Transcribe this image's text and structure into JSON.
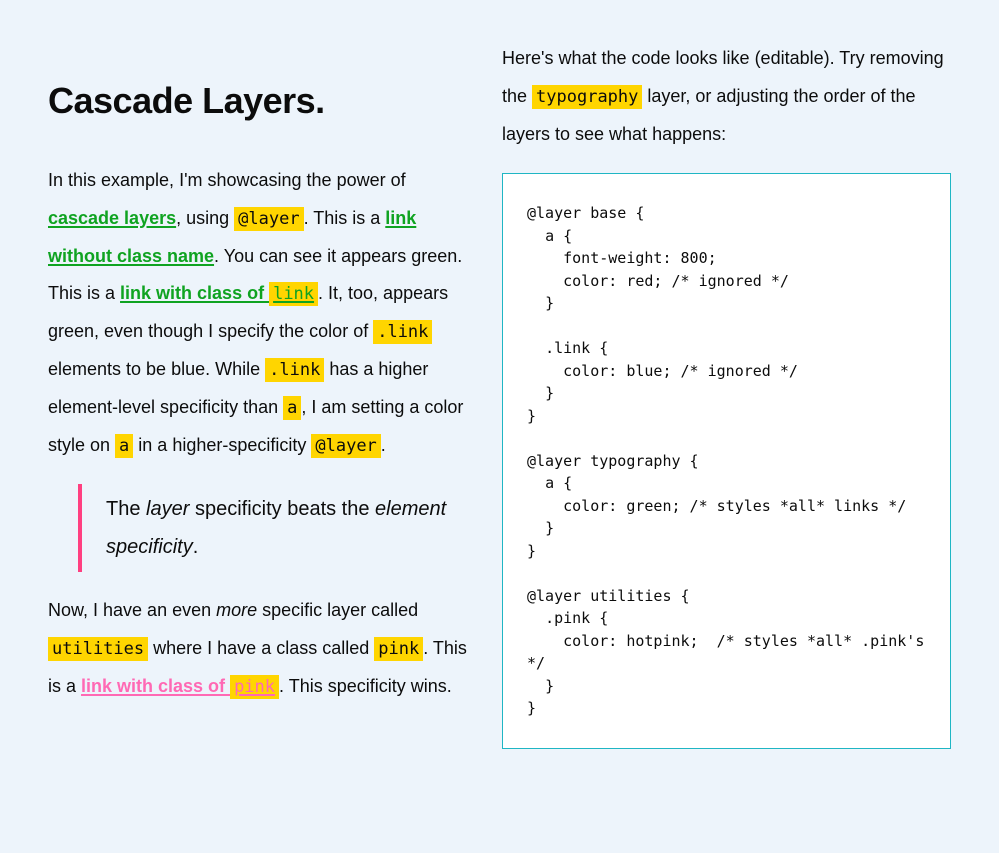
{
  "heading": "Cascade Layers.",
  "p1": {
    "t1": "In this example, I'm showcasing the power of ",
    "link1": "cascade layers",
    "t2": ", using ",
    "code_layer": "@layer",
    "t3": ". This is a ",
    "link2": "link without class name",
    "t4": ". You can see it appears green. This is a ",
    "link3_pre": "link with class of ",
    "link3_code": "link",
    "t5": ". It, too, appears green, even though I specify the color of ",
    "code_dotlink1": ".link",
    "t6": " elements to be blue. While ",
    "code_dotlink2": ".link",
    "t7": " has a higher element-level specificity than ",
    "code_a1": "a",
    "t8": ", I am setting a color style on ",
    "code_a2": "a",
    "t9": " in a higher-specificity ",
    "code_layer2": "@layer",
    "t10": "."
  },
  "bq": {
    "t1": "The ",
    "em1": "layer",
    "t2": " specificity beats the ",
    "em2": "element specificity",
    "t3": "."
  },
  "p2": {
    "t1": "Now, I have an even ",
    "em_more": "more",
    "t2": " specific layer called ",
    "code_util": "utilities",
    "t3": " where I have a class called ",
    "code_pink": "pink",
    "t4": ". This is a ",
    "link_pre": "link with class of ",
    "link_code": "pink",
    "t5": ". This specificity wins."
  },
  "p3": {
    "t1": "Here's what the code looks like (editable). Try removing the ",
    "code_typo": "typography",
    "t2": " layer, or adjusting the order of the layers to see what happens:"
  },
  "code_block": "@layer base {\n  a {\n    font-weight: 800;\n    color: red; /* ignored */\n  }\n\n  .link {\n    color: blue; /* ignored */\n  }\n}\n\n@layer typography {\n  a {\n    color: green; /* styles *all* links */\n  }\n}\n\n@layer utilities {\n  .pink {\n    color: hotpink;  /* styles *all* .pink's */\n  }\n}"
}
